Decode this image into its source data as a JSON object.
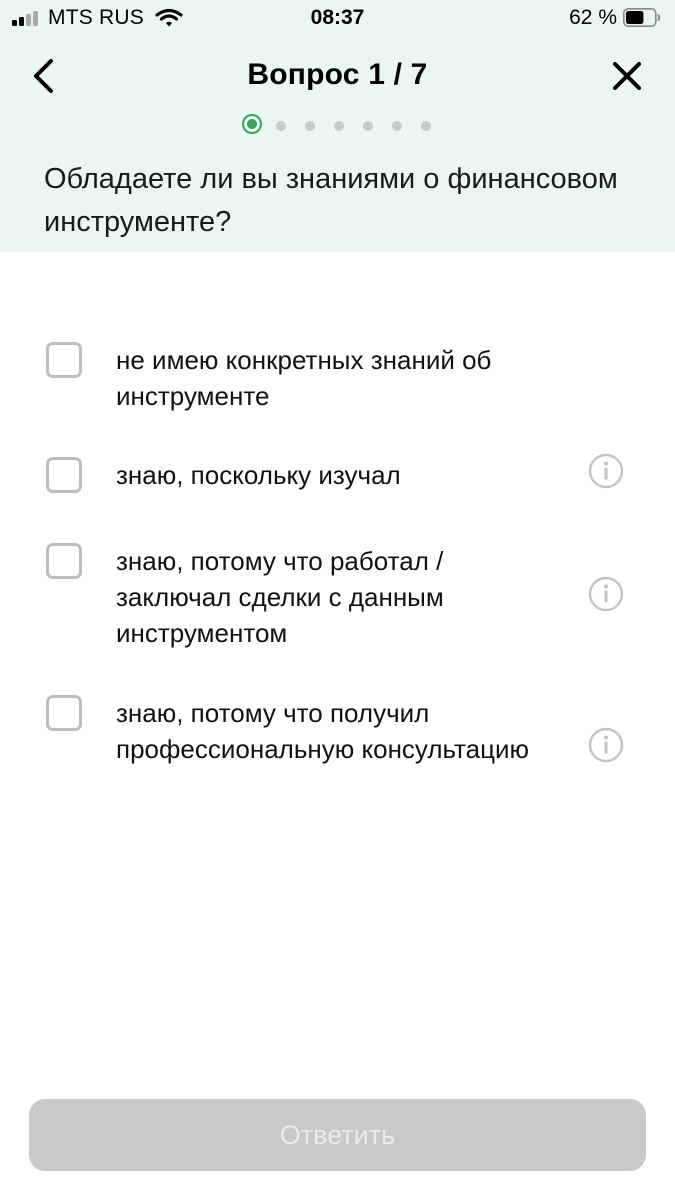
{
  "status_bar": {
    "carrier": "MTS RUS",
    "time": "08:37",
    "battery_percent": "62 %",
    "battery_level": 0.62,
    "signal_bars": 2
  },
  "header": {
    "title": "Вопрос 1 / 7",
    "back_icon": "chevron-left-icon",
    "close_icon": "close-icon"
  },
  "progress": {
    "current": 1,
    "total": 7
  },
  "question": "Обладаете ли вы знаниями о финансовом инструменте?",
  "options": [
    {
      "label": "не имею конкретных знаний об инструменте",
      "checked": false,
      "has_info": false
    },
    {
      "label": "знаю, поскольку изучал",
      "checked": false,
      "has_info": true
    },
    {
      "label": "знаю, потому что работал / заключал сделки с данным инструментом",
      "checked": false,
      "has_info": true
    },
    {
      "label": "знаю, потому что получил профессиональную консультацию",
      "checked": false,
      "has_info": true
    }
  ],
  "submit": {
    "label": "Ответить",
    "enabled": false
  },
  "colors": {
    "header_bg": "#e9f6f1",
    "accent": "#3aa455",
    "disabled_button": "#c9c9c9",
    "checkbox_border": "#bdbdbd"
  }
}
